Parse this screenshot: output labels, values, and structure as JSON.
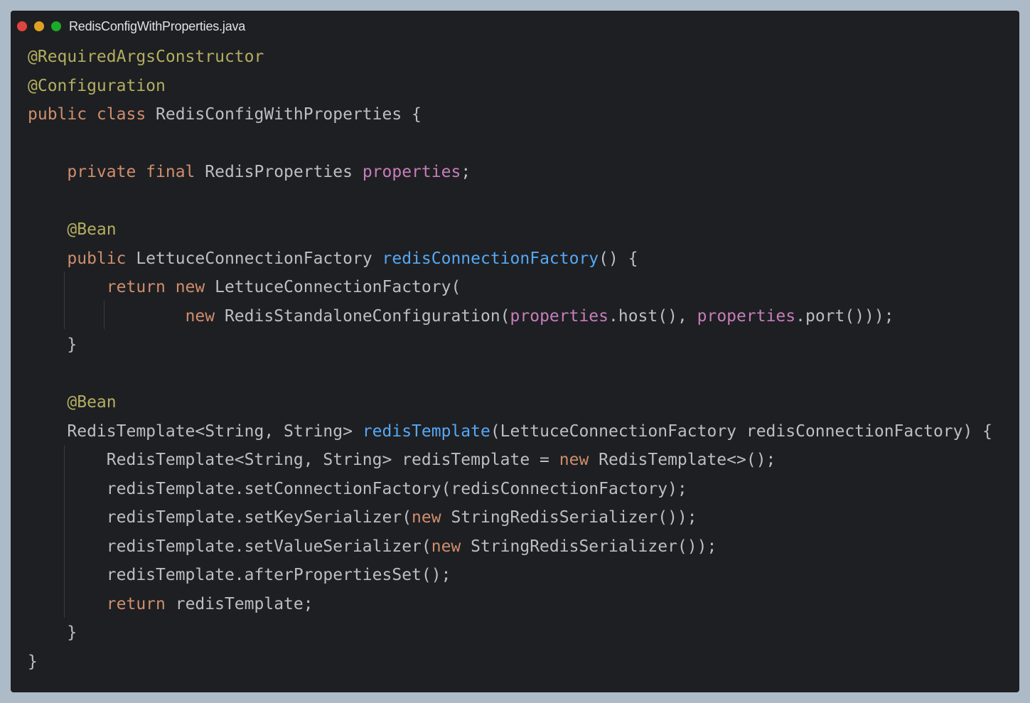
{
  "window": {
    "filename": "RedisConfigWithProperties.java",
    "traffic_lights": [
      "close",
      "minimize",
      "maximize"
    ]
  },
  "theme": {
    "background": "#1e1f22",
    "text": "#bcbec4",
    "annotation": "#b3ae60",
    "keyword": "#cf8e6d",
    "field": "#c77dbb",
    "method": "#56a8f5",
    "page_background": "#adbac7"
  },
  "code": {
    "lines": [
      [
        [
          "ann",
          "@RequiredArgsConstructor"
        ]
      ],
      [
        [
          "ann",
          "@Configuration"
        ]
      ],
      [
        [
          "kw",
          "public class "
        ],
        [
          "txt",
          "RedisConfigWithProperties {"
        ]
      ],
      [],
      [
        [
          "txt",
          "    "
        ],
        [
          "kw",
          "private final "
        ],
        [
          "txt",
          "RedisProperties "
        ],
        [
          "fld",
          "properties"
        ],
        [
          "txt",
          ";"
        ]
      ],
      [],
      [
        [
          "txt",
          "    "
        ],
        [
          "ann",
          "@Bean"
        ]
      ],
      [
        [
          "txt",
          "    "
        ],
        [
          "kw",
          "public "
        ],
        [
          "txt",
          "LettuceConnectionFactory "
        ],
        [
          "fn",
          "redisConnectionFactory"
        ],
        [
          "txt",
          "() {"
        ]
      ],
      [
        [
          "txt",
          "        "
        ],
        [
          "kw",
          "return new "
        ],
        [
          "txt",
          "LettuceConnectionFactory("
        ]
      ],
      [
        [
          "txt",
          "                "
        ],
        [
          "kw",
          "new "
        ],
        [
          "txt",
          "RedisStandaloneConfiguration("
        ],
        [
          "fld",
          "properties"
        ],
        [
          "txt",
          ".host(), "
        ],
        [
          "fld",
          "properties"
        ],
        [
          "txt",
          ".port()));"
        ]
      ],
      [
        [
          "txt",
          "    }"
        ]
      ],
      [],
      [
        [
          "txt",
          "    "
        ],
        [
          "ann",
          "@Bean"
        ]
      ],
      [
        [
          "txt",
          "    RedisTemplate<String, String> "
        ],
        [
          "fn",
          "redisTemplate"
        ],
        [
          "txt",
          "(LettuceConnectionFactory redisConnectionFactory) {"
        ]
      ],
      [
        [
          "txt",
          "        RedisTemplate<String, String> redisTemplate = "
        ],
        [
          "kw",
          "new "
        ],
        [
          "txt",
          "RedisTemplate<>();"
        ]
      ],
      [
        [
          "txt",
          "        redisTemplate.setConnectionFactory(redisConnectionFactory);"
        ]
      ],
      [
        [
          "txt",
          "        redisTemplate.setKeySerializer("
        ],
        [
          "kw",
          "new "
        ],
        [
          "txt",
          "StringRedisSerializer());"
        ]
      ],
      [
        [
          "txt",
          "        redisTemplate.setValueSerializer("
        ],
        [
          "kw",
          "new "
        ],
        [
          "txt",
          "StringRedisSerializer());"
        ]
      ],
      [
        [
          "txt",
          "        redisTemplate.afterPropertiesSet();"
        ]
      ],
      [
        [
          "txt",
          "        "
        ],
        [
          "kw",
          "return "
        ],
        [
          "txt",
          "redisTemplate;"
        ]
      ],
      [
        [
          "txt",
          "    }"
        ]
      ],
      [
        [
          "txt",
          "}"
        ]
      ]
    ]
  }
}
